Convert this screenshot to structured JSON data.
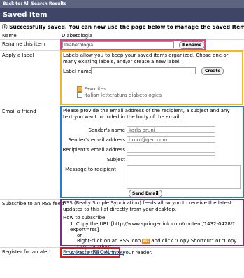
{
  "back_link": "Back to: All Search Results",
  "page_title": "Saved Item",
  "success_message": "Successfully saved. You can now use the page below to manage the Saved Item.",
  "name_row": {
    "label": "Name",
    "value": "Diabetologia"
  },
  "rename_row": {
    "label": "Rename this item",
    "input_value": "Diabetologia",
    "button": "Rename"
  },
  "label_row": {
    "label": "Apply a label",
    "description": "Labels allow you to keep your saved items organized. Chose one or many existing labels, and/or create a new label.",
    "label_name": "Label name:",
    "button": "Create",
    "labels": [
      "Favorites",
      "Italian letteratura diabetologica"
    ]
  },
  "email_row": {
    "label": "Email a friend",
    "description": "Please provide the email address of the recipient, a subject and any text you want included in the body of the email.",
    "sender_name_label": "Sender's name",
    "sender_name_value": "karla bruni",
    "sender_email_label": "Sender's email address",
    "sender_email_value": "bruni@geo.com",
    "recipient_label": "Recipient's email address",
    "subject_label": "Subject",
    "message_label": "Message to recipient",
    "button": "Send Email"
  },
  "rss_row": {
    "label": "Subscribe to an RSS feed",
    "description": "RSS (Really Simple Syndication) feeds allow you to receive the latest updates to this list directly from your desktop.",
    "how_to": "How to subscribe:",
    "step1": "Copy the URL [http://www.springerlink.com/content/1432-0428/?export=rss]",
    "or": "or",
    "alt": "Right-click on an RSS icon",
    "alt2": "and click \"Copy Shortcut\" or \"Copy Link Location\".",
    "step2": "Paste the URL into your reader.",
    "rss_icon_text": "RSS"
  },
  "alert_row": {
    "label": "Register for an alert",
    "link": "Register for TOC Alerting"
  },
  "colors": {
    "header": "#3e4566",
    "link": "#1b4fa0",
    "rss": "#f08a24"
  }
}
